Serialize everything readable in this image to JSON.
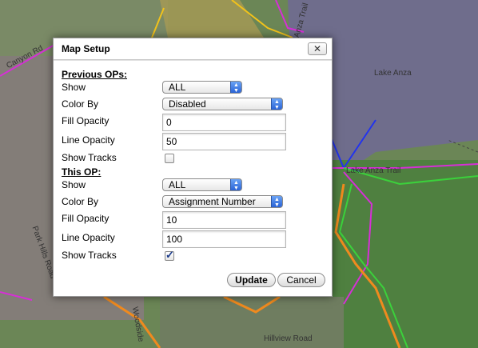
{
  "map": {
    "labels": [
      "Lake Anza",
      "Canyon Rd",
      "Park Hills Road",
      "Woodside",
      "Lake Anza Trail",
      "Anza Trail",
      "Hillview Road"
    ],
    "colors": {
      "magenta": "#d62fd6",
      "yellow": "#f2c21a",
      "orange": "#f08a1e",
      "green": "#3bd13b",
      "blue": "#2233ee"
    }
  },
  "dialog": {
    "title": "Map Setup",
    "close_label": "✕",
    "previous_ops": {
      "header": "Previous OPs:",
      "show_label": "Show",
      "show_value": "ALL",
      "color_by_label": "Color By",
      "color_by_value": "Disabled",
      "fill_opacity_label": "Fill Opacity",
      "fill_opacity_value": "0",
      "line_opacity_label": "Line Opacity",
      "line_opacity_value": "50",
      "show_tracks_label": "Show Tracks",
      "show_tracks_checked": false
    },
    "this_op": {
      "header": "This OP:",
      "show_label": "Show",
      "show_value": "ALL",
      "color_by_label": "Color By",
      "color_by_value": "Assignment Number",
      "fill_opacity_label": "Fill Opacity",
      "fill_opacity_value": "10",
      "line_opacity_label": "Line Opacity",
      "line_opacity_value": "100",
      "show_tracks_label": "Show Tracks",
      "show_tracks_checked": true
    },
    "update_label": "Update",
    "cancel_label": "Cancel"
  }
}
